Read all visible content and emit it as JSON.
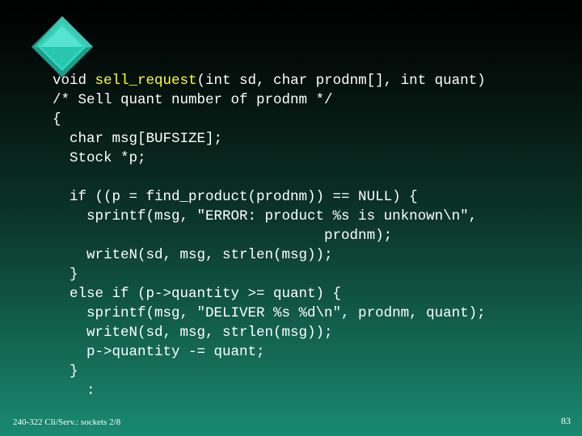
{
  "slide": {
    "bullet_icon": "diamond-bullet-icon",
    "colors": {
      "background_top": "#000000",
      "background_bottom": "#1a8a72",
      "text": "#ffffff",
      "highlight": "#ffff33",
      "diamond_fill": "#33d6bf"
    },
    "code": {
      "signature": {
        "before": "void ",
        "function_name": "sell_request",
        "after": "(int sd, char prodnm[], int quant)"
      },
      "lines": [
        "/* Sell quant number of prodnm */",
        "{",
        "  char msg[BUFSIZE];",
        "  Stock *p;",
        "",
        "  if ((p = find_product(prodnm)) == NULL) {",
        "    sprintf(msg, \"ERROR: product %s is unknown\\n\",",
        "                                prodnm);",
        "    writeN(sd, msg, strlen(msg));",
        "  }",
        "  else if (p->quantity >= quant) {",
        "    sprintf(msg, \"DELIVER %s %d\\n\", prodnm, quant);",
        "    writeN(sd, msg, strlen(msg));",
        "    p->quantity -= quant;",
        "  }",
        "    :"
      ]
    },
    "footer": {
      "course": "240-322 Cli/Serv.: sockets 2/8",
      "page_number": "83"
    }
  }
}
